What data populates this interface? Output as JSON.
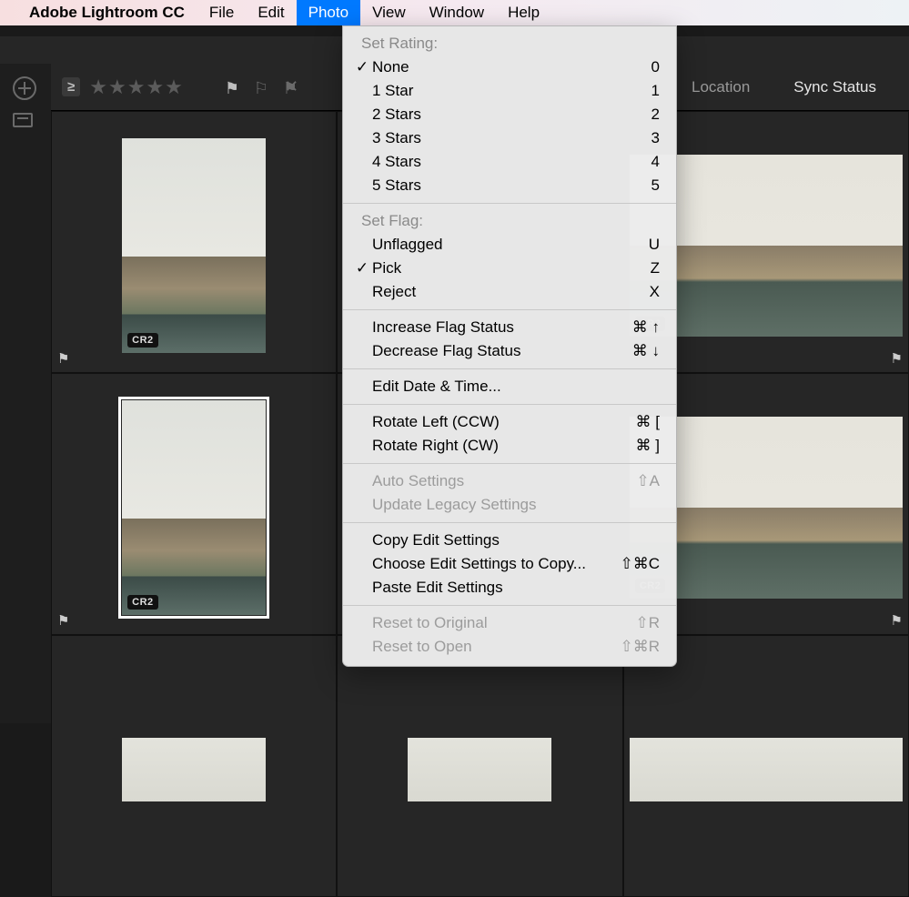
{
  "menubar": {
    "app_name": "Adobe Lightroom CC",
    "items": [
      "File",
      "Edit",
      "Photo",
      "View",
      "Window",
      "Help"
    ],
    "active_index": 2
  },
  "toolbar": {
    "filter_symbol": "≥",
    "tabs": {
      "location": "Location",
      "sync": "Sync Status"
    }
  },
  "thumb_badge": "CR2",
  "menu": {
    "sections": [
      {
        "header": "Set Rating:",
        "items": [
          {
            "label": "None",
            "shortcut": "0",
            "checked": true
          },
          {
            "label": "1 Star",
            "shortcut": "1"
          },
          {
            "label": "2 Stars",
            "shortcut": "2"
          },
          {
            "label": "3 Stars",
            "shortcut": "3"
          },
          {
            "label": "4 Stars",
            "shortcut": "4"
          },
          {
            "label": "5 Stars",
            "shortcut": "5"
          }
        ]
      },
      {
        "header": "Set Flag:",
        "items": [
          {
            "label": "Unflagged",
            "shortcut": "U"
          },
          {
            "label": "Pick",
            "shortcut": "Z",
            "checked": true
          },
          {
            "label": "Reject",
            "shortcut": "X"
          }
        ]
      },
      {
        "items": [
          {
            "label": "Increase Flag Status",
            "shortcut": "⌘ ↑"
          },
          {
            "label": "Decrease Flag Status",
            "shortcut": "⌘ ↓"
          }
        ]
      },
      {
        "items": [
          {
            "label": "Edit Date & Time..."
          }
        ]
      },
      {
        "items": [
          {
            "label": "Rotate Left (CCW)",
            "shortcut": "⌘ ["
          },
          {
            "label": "Rotate Right (CW)",
            "shortcut": "⌘ ]"
          }
        ]
      },
      {
        "items": [
          {
            "label": "Auto Settings",
            "shortcut": "⇧A",
            "disabled": true
          },
          {
            "label": "Update Legacy Settings",
            "disabled": true
          }
        ]
      },
      {
        "items": [
          {
            "label": "Copy Edit Settings"
          },
          {
            "label": "Choose Edit Settings to Copy...",
            "shortcut": "⇧⌘C"
          },
          {
            "label": "Paste Edit Settings"
          }
        ]
      },
      {
        "items": [
          {
            "label": "Reset to Original",
            "shortcut": "⇧R",
            "disabled": true
          },
          {
            "label": "Reset to Open",
            "shortcut": "⇧⌘R",
            "disabled": true
          }
        ]
      }
    ]
  }
}
